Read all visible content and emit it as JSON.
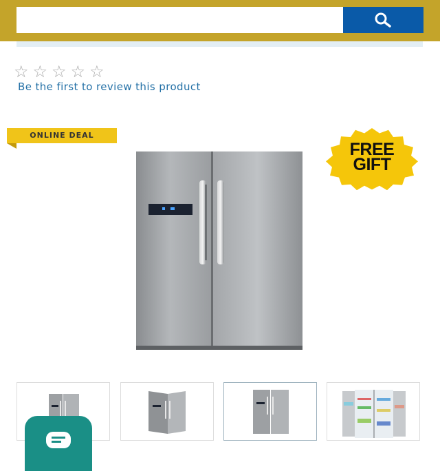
{
  "search": {
    "placeholder": "",
    "value": "",
    "button_icon": "search-icon"
  },
  "rating": {
    "stars": [
      "☆",
      "☆",
      "☆",
      "☆",
      "☆"
    ],
    "filled": 0,
    "review_link": "Be the first to review this product"
  },
  "badges": {
    "online_deal": "ONLINE DEAL",
    "free_gift_line1": "FREE",
    "free_gift_line2": "GIFT"
  },
  "product_image": {
    "icon": "refrigerator-icon"
  },
  "thumbnails": [
    {
      "icon": "fridge-front-thumbnail"
    },
    {
      "icon": "fridge-angle-thumbnail"
    },
    {
      "icon": "fridge-front-thumbnail",
      "active": true
    },
    {
      "icon": "fridge-open-thumbnail"
    }
  ],
  "chat": {
    "icon": "chat-icon"
  },
  "colors": {
    "header": "#c4a42a",
    "search_button": "#0a5aa8",
    "link": "#2370a6",
    "deal_badge": "#f0c419",
    "gift_badge": "#f5c60a",
    "chat": "#1a8f86"
  }
}
